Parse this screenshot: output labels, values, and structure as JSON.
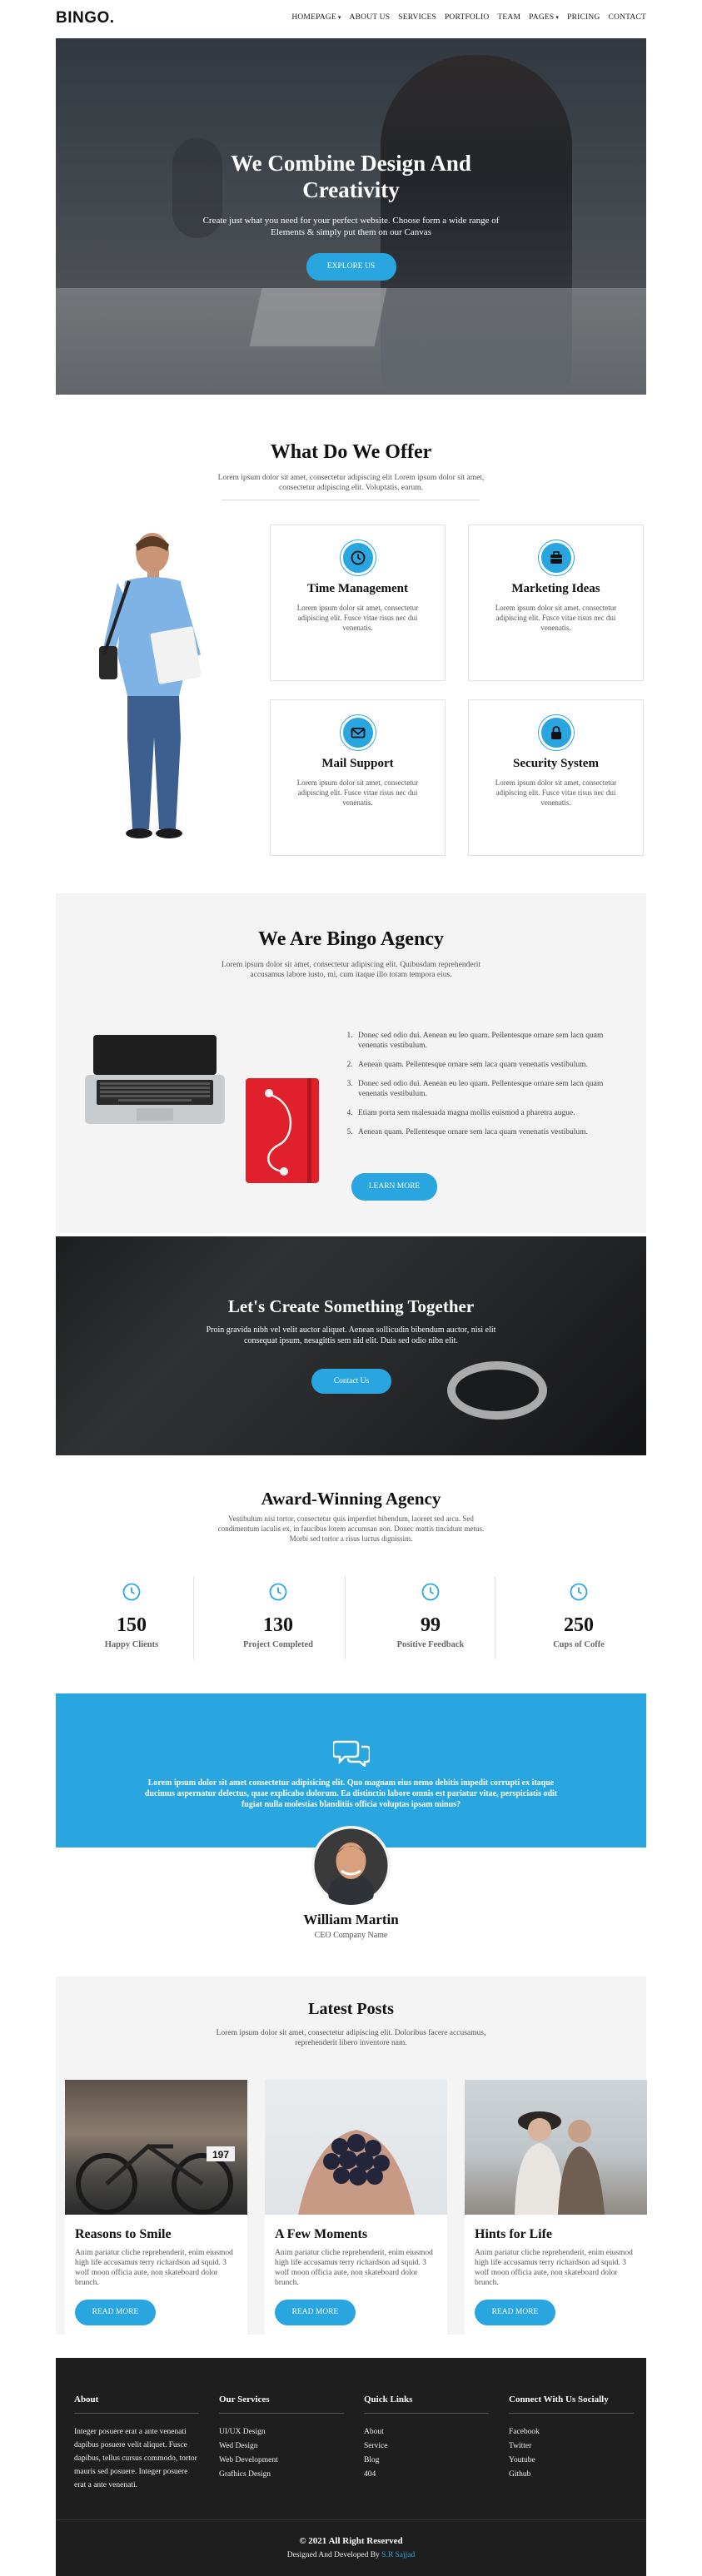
{
  "brand": "BINGO.",
  "nav": [
    {
      "label": "HOMEPAGE",
      "dropdown": true
    },
    {
      "label": "ABOUT US",
      "dropdown": false
    },
    {
      "label": "SERVICES",
      "dropdown": false
    },
    {
      "label": "PORTFOLIO",
      "dropdown": false
    },
    {
      "label": "TEAM",
      "dropdown": false
    },
    {
      "label": "PAGES",
      "dropdown": true
    },
    {
      "label": "PRICING",
      "dropdown": false
    },
    {
      "label": "CONTACT",
      "dropdown": false
    }
  ],
  "hero": {
    "title": "We Combine Design And Creativity",
    "text": "Create just what you need for your perfect website. Choose form a wide range of Elements & simply put them on our Canvas",
    "button": "EXPLORE US"
  },
  "offer": {
    "title": "What Do We Offer",
    "subtitle": "Lorem ipsum dolor sit amet, consectetur adipiscing elit Lorem ipsum dolor sit amet, consectetur adipiscing elit. Voluptatis, earum.",
    "cards": [
      {
        "icon": "clock-icon",
        "title": "Time Management",
        "text": "Lorem ipsum dolor sit amet, consectetur adipiscing elit. Fusce vitae risus nec dui venenatis."
      },
      {
        "icon": "briefcase-icon",
        "title": "Marketing Ideas",
        "text": "Lorem ipsum dolor sit amet, consectetur adipiscing elit. Fusce vitae risus nec dui venenatis."
      },
      {
        "icon": "envelope-icon",
        "title": "Mail Support",
        "text": "Lorem ipsum dolor sit amet, consectetur adipiscing elit. Fusce vitae risus nec dui venenatis."
      },
      {
        "icon": "lock-icon",
        "title": "Security System",
        "text": "Lorem ipsum dolor sit amet, consectetur adipiscing elit. Fusce vitae risus nec dui venenatis."
      }
    ]
  },
  "agency": {
    "title": "We Are Bingo Agency",
    "subtitle": "Lorem ipsum dolor sit amet, consectetur adipiscing elit. Quibusdam reprehenderit accusamus labore iusto, mi, cum itaque illo totam tempora eius.",
    "list": [
      "Donec sed odio dui. Aenean eu leo quam. Pellentesque ornare sem lacn quam venenatis vestibulum.",
      "Aenean quam. Pellentesque ornare sem laca quam venenatis vestibulum.",
      "Donec sed odio dui. Aenean eu leo quam. Pellentesque ornare sem lacn quam venenatis vestibulum.",
      "Etiam porta sem malesuada magna mollis euismod a pharetra augue.",
      "Aenean quam. Pellentesque ornare sem laca quam venenatis vestibulum."
    ],
    "button": "LEARN MORE"
  },
  "cta": {
    "title": "Let's Create Something Together",
    "text": "Proin gravida nibh vel velit auctor aliquet. Aenean sollicudin bibendum auctor, nisi elit consequat ipsum, nesagittis sem nid elit. Duis sed odio nibn elit.",
    "button": "Contact Us"
  },
  "award": {
    "title": "Award-Winning Agency",
    "subtitle": "Vestibulum nisi tortor, consectetur quis imperdiet bibendum, laoreet sed arcu. Sed condimentum iaculis ex, in faucibus lorem accumsan non. Donec mattis tincidunt metus. Morbi sed tortor a risus luctus dignissim.",
    "stats": [
      {
        "value": "150",
        "label": "Happy Clients"
      },
      {
        "value": "130",
        "label": "Project Completed"
      },
      {
        "value": "99",
        "label": "Positive Feedback"
      },
      {
        "value": "250",
        "label": "Cups of Coffe"
      }
    ]
  },
  "testimonial": {
    "text": "Lorem ipsum dolor sit amet consectetur adipisicing elit. Quo magnam eius nemo debitis impedit corrupti ex itaque ducimus aspernatur delectus, quae explicabo dolorum. Ea distinctio labore omnis est pariatur vitae, perspiciatis odit fugiat nulla molestias blanditiis officia voluptas ipsam minus?",
    "name": "William Martin",
    "role": "CEO Company Name"
  },
  "posts": {
    "title": "Latest Posts",
    "subtitle": "Lorem ipsum dolor sit amet, consectetur adipiscing elit. Doloribus facere accusamus, reprehenderit libero inventore nam.",
    "items": [
      {
        "title": "Reasons to Smile",
        "text": "Anim pariatur cliche reprehenderit, enim eiusmod high life accusamus terry richardson ad squid. 3 wolf moon officia aute, non skateboard dolor brunch.",
        "button": "READ MORE",
        "badge": "197"
      },
      {
        "title": "A Few Moments",
        "text": "Anim pariatur cliche reprehenderit, enim eiusmod high life accusamus terry richardson ad squid. 3 wolf moon officia aute, non skateboard dolor brunch.",
        "button": "READ MORE"
      },
      {
        "title": "Hints for Life",
        "text": "Anim pariatur cliche reprehenderit, enim eiusmod high life accusamus terry richardson ad squid. 3 wolf moon officia aute, non skateboard dolor brunch.",
        "button": "READ MORE"
      }
    ]
  },
  "footer": {
    "about": {
      "title": "About",
      "text": "Integer posuere erat a ante venenati dapibus posuere velit aliquet. Fusce dapibus, tellus cursus commodo, tortor mauris sed posuere. Integer posuere erat a ante venenati."
    },
    "services": {
      "title": "Our Services",
      "items": [
        "UI/UX Design",
        "Wed Design",
        "Web Development",
        "Grafhics Design"
      ]
    },
    "links": {
      "title": "Quick Links",
      "items": [
        "About",
        "Service",
        "Blog",
        "404"
      ]
    },
    "social": {
      "title": "Connect With Us Socially",
      "items": [
        "Facebook",
        "Twitter",
        "Youtube",
        "Github"
      ]
    },
    "copyright": "© 2021 All Right Reserved",
    "designed_prefix": "Designed And Developed By",
    "designed_author": "S.R Sajjad"
  },
  "colors": {
    "accent": "#29a6e0",
    "footer_bg": "#1e1e1e",
    "section_bg": "#f4f4f4"
  }
}
